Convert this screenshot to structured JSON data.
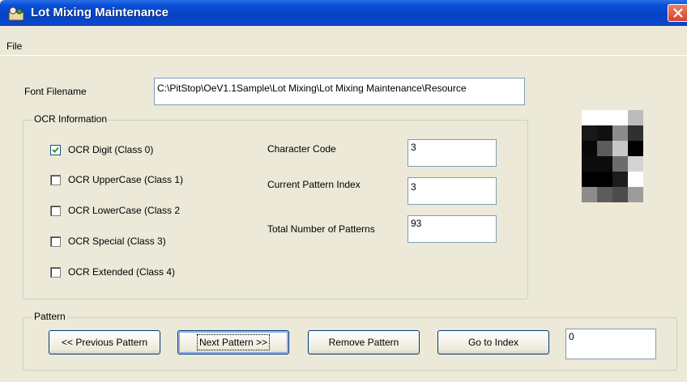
{
  "window": {
    "title": "Lot Mixing Maintenance"
  },
  "menu": {
    "file": "File"
  },
  "font_filename": {
    "label": "Font Filename",
    "value": "C:\\PitStop\\OeV1.1Sample\\Lot Mixing\\Lot Mixing Maintenance\\Resource"
  },
  "ocr": {
    "group_title": "OCR Information",
    "classes": [
      {
        "label": "OCR Digit (Class 0)",
        "checked": true
      },
      {
        "label": "OCR UpperCase (Class 1)",
        "checked": false
      },
      {
        "label": "OCR LowerCase (Class 2",
        "checked": false
      },
      {
        "label": "OCR Special (Class 3)",
        "checked": false
      },
      {
        "label": "OCR Extended (Class 4)",
        "checked": false
      }
    ],
    "character_code": {
      "label": "Character Code",
      "value": "3"
    },
    "current_pattern_index": {
      "label": "Current Pattern Index",
      "value": "3"
    },
    "total_patterns": {
      "label": "Total Number of Patterns",
      "value": "93"
    }
  },
  "pattern": {
    "group_title": "Pattern",
    "previous_label": "<< Previous Pattern",
    "next_label": "Next Pattern >>",
    "remove_label": "Remove Pattern",
    "goto_label": "Go to Index",
    "index_value": "0"
  },
  "pattern_preview": {
    "columns": 4,
    "rows": 6,
    "grays": [
      "#ffffff",
      "#ffffff",
      "#ffffff",
      "#bcbcbc",
      "#181818",
      "#101010",
      "#8c8c8c",
      "#303030",
      "#080808",
      "#5c5c5c",
      "#c8c8c8",
      "#000000",
      "#0c0c0c",
      "#0c0c0c",
      "#6c6c6c",
      "#d4d4d4",
      "#000000",
      "#000000",
      "#1c1c1c",
      "#ffffff",
      "#8c8c8c",
      "#5c5c5c",
      "#4c4c4c",
      "#9c9c9c"
    ]
  },
  "colors": {
    "title_bar": "#0a50d7",
    "window_bg": "#ece9d8",
    "close_button": "#d4442a"
  }
}
